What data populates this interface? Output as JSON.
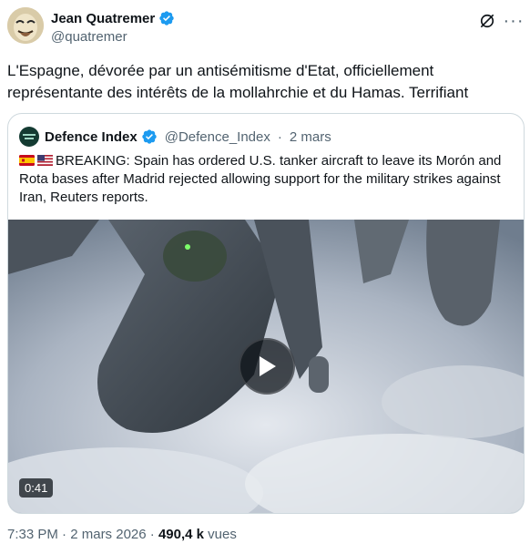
{
  "author": {
    "display_name": "Jean Quatremer",
    "handle": "@quatremer",
    "verified_icon": "verified-badge-icon"
  },
  "actions": {
    "grok_icon": "grok-icon",
    "more_icon": "more-options-icon",
    "more_label": "···"
  },
  "tweet": {
    "text": "L'Espagne, dévorée par un antisémitisme d'Etat, officiellement représentante des intérêts de la mollahrchie et du Hamas. Terrifiant"
  },
  "quote": {
    "display_name": "Defence Index",
    "handle": "@Defence_Index",
    "separator": "·",
    "date": "2 mars",
    "text": "BREAKING: Spain has ordered U.S. tanker aircraft to leave its Morón and Rota bases after Madrid rejected allowing support for the military strikes against Iran, Reuters reports.",
    "flags": [
      "spain-flag-icon",
      "us-flag-icon"
    ],
    "video": {
      "duration": "0:41",
      "play_icon": "play-icon"
    }
  },
  "meta": {
    "time": "7:33 PM",
    "date": "2 mars 2026",
    "separator": "·",
    "views_count": "490,4 k",
    "views_label": "vues"
  },
  "colors": {
    "text": "#0f1419",
    "secondary": "#536471",
    "verified": "#1d9bf0",
    "border": "#cfd9de"
  }
}
